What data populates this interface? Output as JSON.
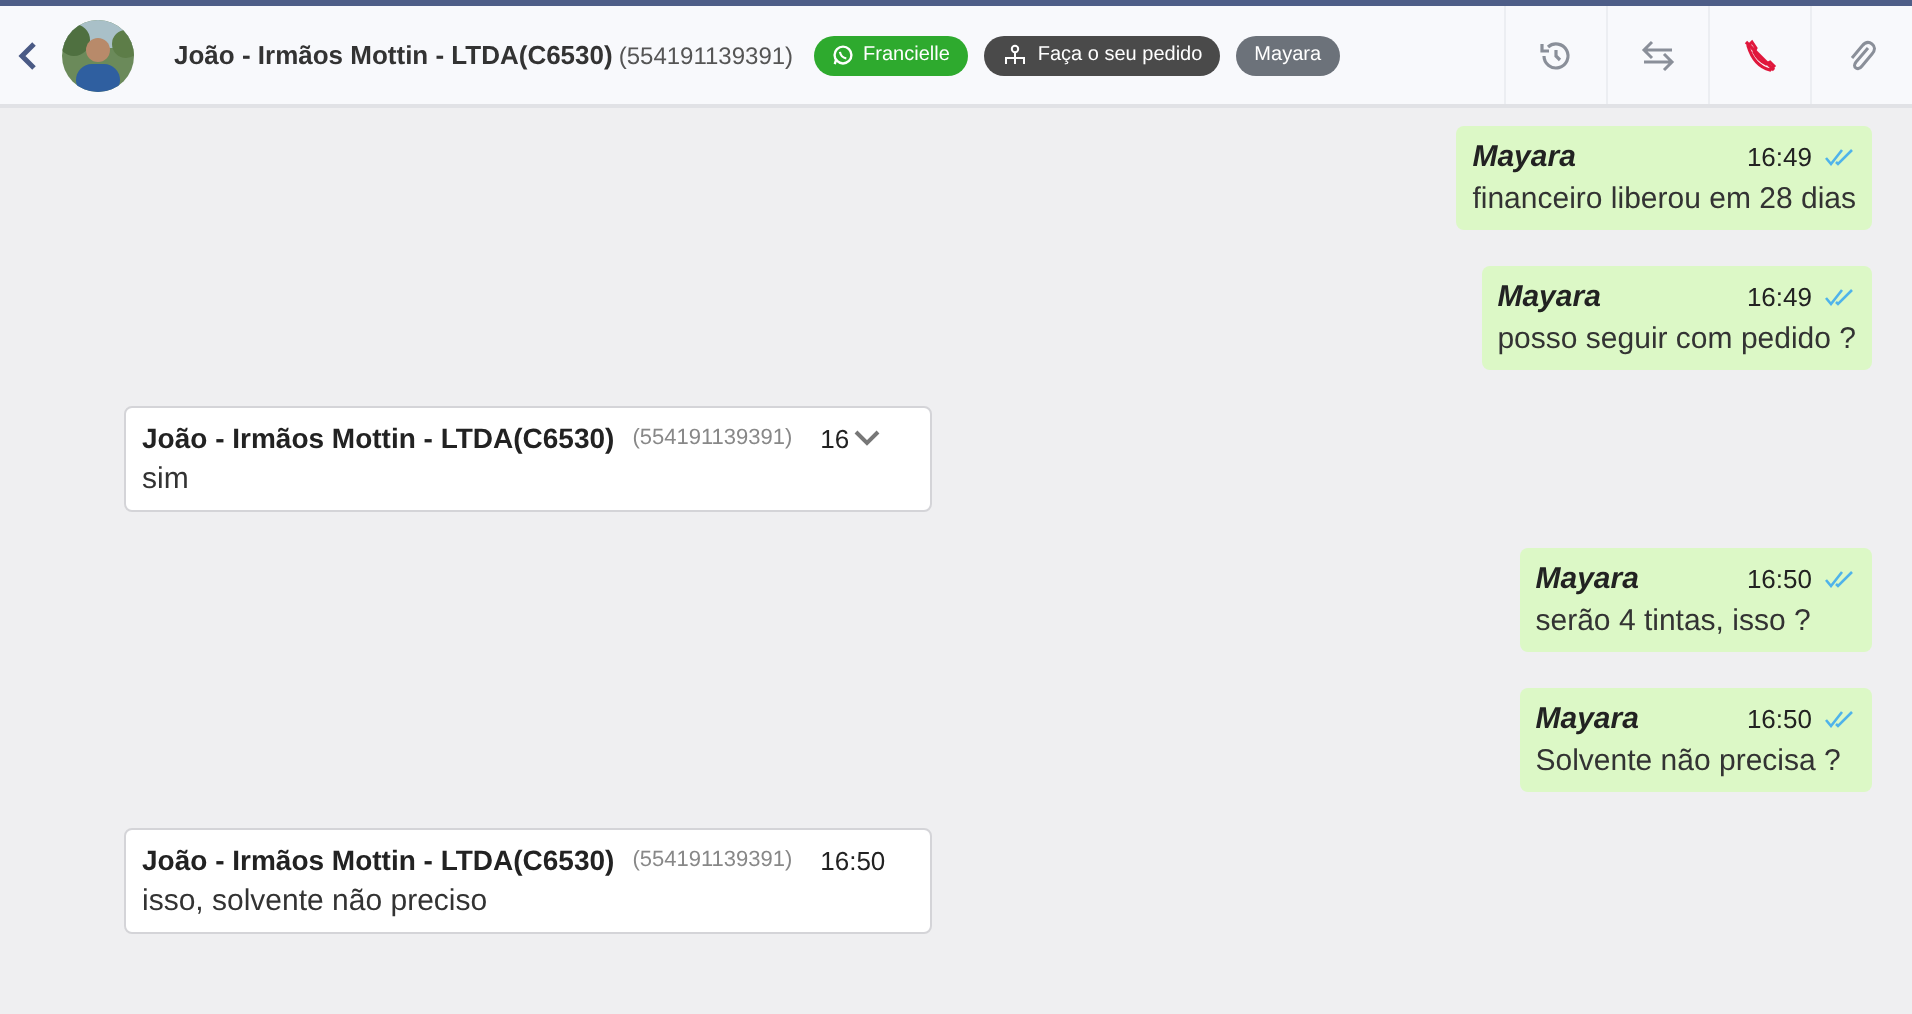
{
  "header": {
    "contact_name": "João - Irmãos Mottin - LTDA(C6530)",
    "contact_phone": "(554191139391)",
    "tags": [
      {
        "label": "Francielle",
        "kind": "whatsapp",
        "color": "#2eaa2e"
      },
      {
        "label": "Faça o seu pedido",
        "kind": "flow",
        "color": "#4a4a4a"
      },
      {
        "label": "Mayara",
        "kind": "plain",
        "color": "#6c727a"
      }
    ]
  },
  "messages": [
    {
      "kind": "outgoing",
      "author": "Mayara",
      "time": "16:49",
      "text": "financeiro liberou em 28 dias",
      "read": true
    },
    {
      "kind": "outgoing",
      "author": "Mayara",
      "time": "16:49",
      "text": "posso seguir com pedido ?",
      "read": true
    },
    {
      "kind": "incoming",
      "author": "João - Irmãos Mottin - LTDA(C6530)",
      "phone": "(554191139391)",
      "time": "16",
      "text": "sim",
      "menu": true
    },
    {
      "kind": "outgoing",
      "author": "Mayara",
      "time": "16:50",
      "text": "serão 4 tintas, isso ?",
      "read": true
    },
    {
      "kind": "outgoing",
      "author": "Mayara",
      "time": "16:50",
      "text": "Solvente não precisa ?",
      "read": true
    },
    {
      "kind": "incoming",
      "author": "João - Irmãos Mottin - LTDA(C6530)",
      "phone": "(554191139391)",
      "time": "16:50",
      "text": "isso, solvente não preciso",
      "menu": false
    }
  ]
}
